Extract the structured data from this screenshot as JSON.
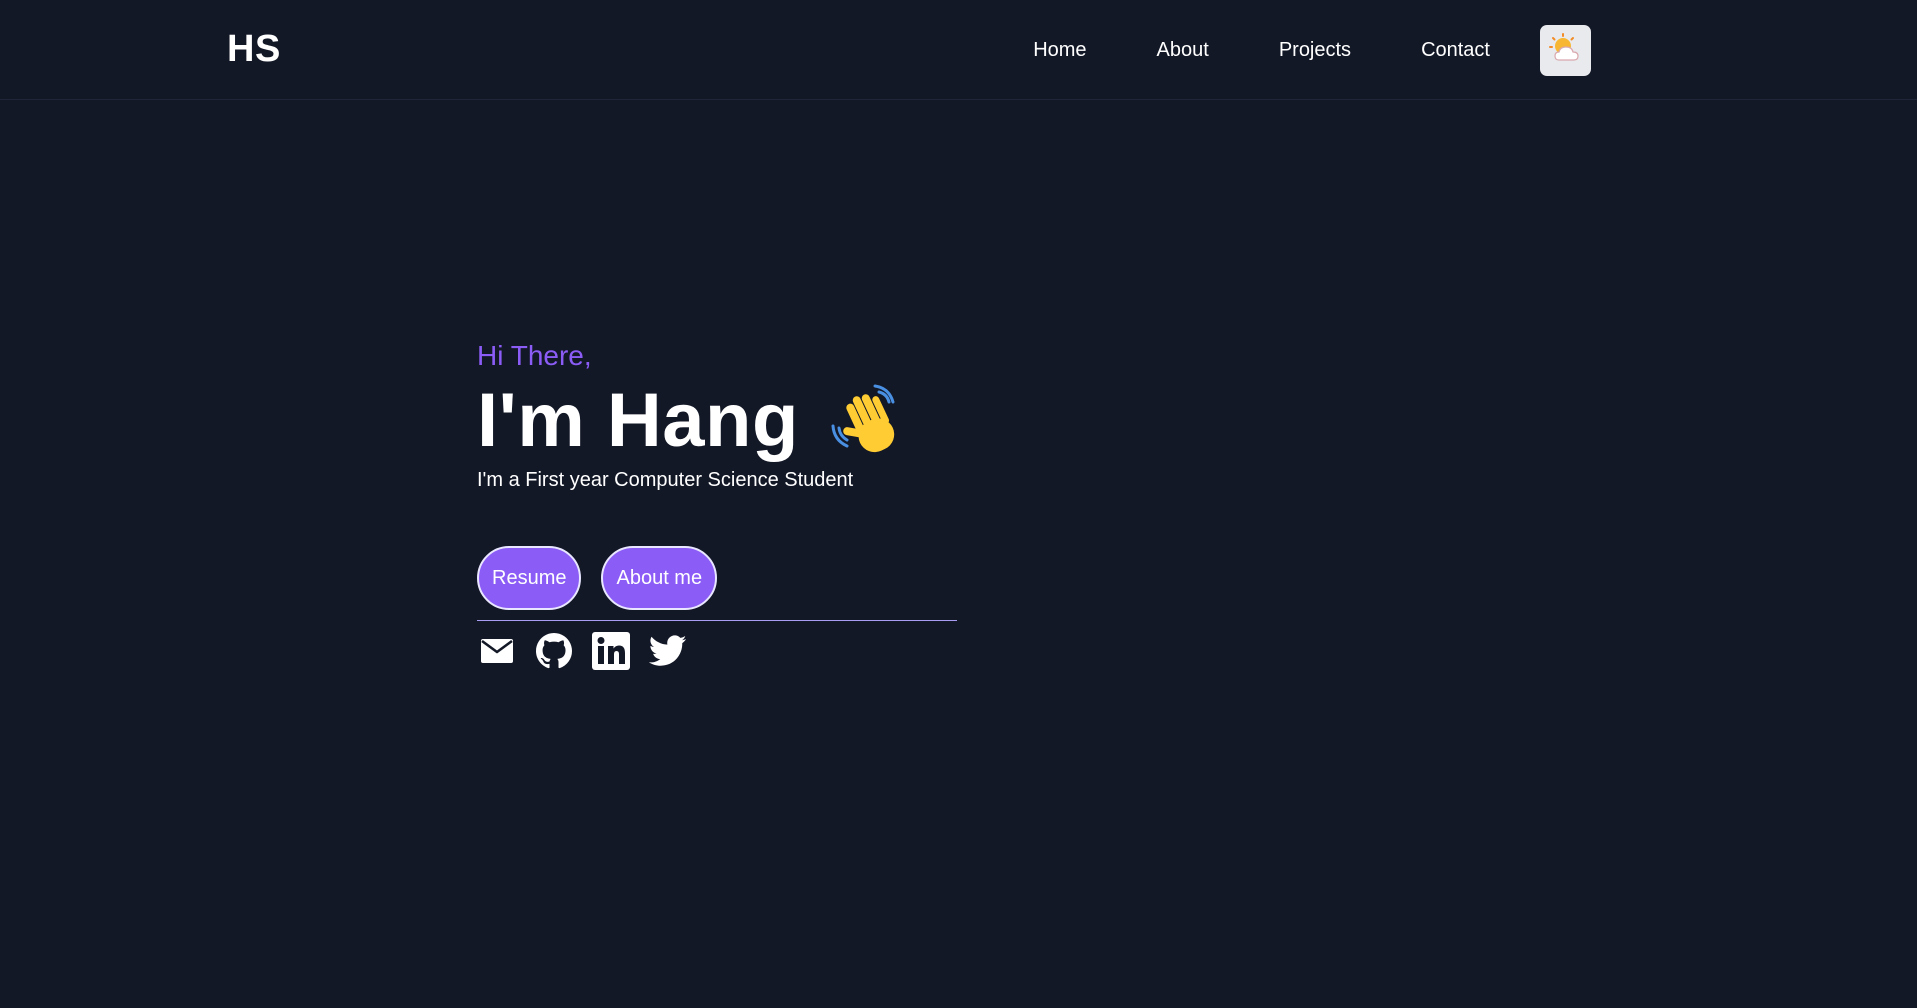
{
  "nav": {
    "logo": "HS",
    "links": [
      "Home",
      "About",
      "Projects",
      "Contact"
    ],
    "theme_toggle_icon": "sun-behind-cloud-icon"
  },
  "hero": {
    "greeting": "Hi There,",
    "headline": "I'm Hang",
    "wave_icon": "waving-hand-icon",
    "subtitle": "I'm a First year Computer Science Student",
    "buttons": [
      "Resume",
      "About me"
    ],
    "socials": [
      "email-icon",
      "github-icon",
      "linkedin-icon",
      "twitter-icon"
    ]
  },
  "colors": {
    "background": "#131827",
    "accent": "#8b5cf6",
    "text": "#ffffff"
  }
}
